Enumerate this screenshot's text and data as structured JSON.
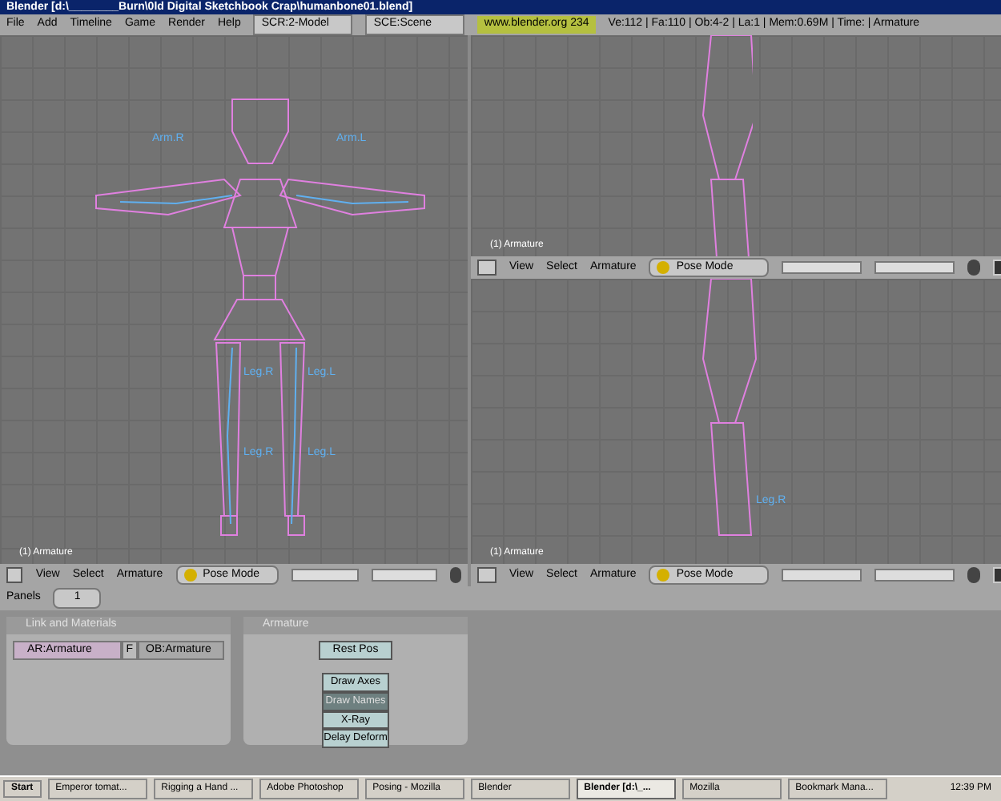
{
  "window": {
    "title": "Blender [d:\\________Burn\\0ld Digital Sketchbook Crap\\humanbone01.blend]"
  },
  "menu": [
    "File",
    "Add",
    "Timeline",
    "Game",
    "Render",
    "Help"
  ],
  "screen_field": {
    "value": "SCR:2-Model"
  },
  "scene_field": {
    "value": "SCE:Scene"
  },
  "info": {
    "link": "www.blender.org 234",
    "stats": "Ve:112 | Fa:110 | Ob:4-2 | La:1 | Mem:0.69M | Time: | Armature"
  },
  "viewports": [
    {
      "label": "(1) Armature",
      "bone_labels": [
        "Arm.R",
        "Arm.L",
        "Leg.R",
        "Leg.L",
        "Leg.R",
        "Leg.L"
      ]
    },
    {
      "label": "(1) Armature"
    },
    {
      "label": "(1) Armature",
      "bone_labels": [
        "Leg.R"
      ]
    }
  ],
  "viewport_headers": [
    {
      "menus": [
        "View",
        "Select",
        "Armature"
      ],
      "mode": "Pose Mode"
    },
    {
      "menus": [
        "View",
        "Select",
        "Armature"
      ],
      "mode": "Pose Mode"
    },
    {
      "menus": [
        "View",
        "Select",
        "Armature"
      ],
      "mode": "Pose Mode"
    }
  ],
  "buttons_header": {
    "label": "Panels",
    "page": "1"
  },
  "link_panel": {
    "title": "Link and Materials",
    "armature_field": "AR:Armature",
    "fake_user": "F",
    "object_field": "OB:Armature"
  },
  "armature_panel": {
    "title": "Armature",
    "rest_button": "Rest Pos",
    "toggles": [
      {
        "label": "Draw Axes",
        "on": false
      },
      {
        "label": "Draw Names",
        "on": true
      },
      {
        "label": "X-Ray",
        "on": false
      },
      {
        "label": "Delay Deform",
        "on": false
      }
    ]
  },
  "taskbar": {
    "start": "Start",
    "tasks": [
      {
        "label": "Emperor tomat...",
        "selected": false
      },
      {
        "label": "Rigging a Hand ...",
        "selected": false
      },
      {
        "label": "Adobe Photoshop",
        "selected": false
      },
      {
        "label": "Posing - Mozilla",
        "selected": false
      },
      {
        "label": "Blender",
        "selected": false
      },
      {
        "label": "Blender [d:\\_...",
        "selected": true
      },
      {
        "label": "Mozilla",
        "selected": false
      },
      {
        "label": "Bookmark Mana...",
        "selected": false
      }
    ],
    "clock": "12:39 PM"
  }
}
